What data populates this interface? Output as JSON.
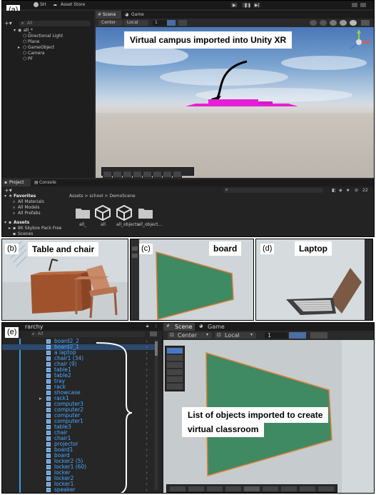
{
  "panel_a": {
    "label": "(a)",
    "toolbar": {
      "account": "SH",
      "asset_store": "Asset Store"
    },
    "hierarchy": {
      "search": "All",
      "scene": "all_*",
      "items": [
        "Directional Light",
        "Plane",
        "GameObject",
        "Camera",
        "PF"
      ]
    },
    "tabs": {
      "scene": "Scene",
      "game": "Game"
    },
    "scene_toolbar": {
      "pivot": "Center",
      "space": "Local",
      "grid_value": "1"
    },
    "caption": "Virtual campus imported into Unity XR",
    "project": {
      "tabs": {
        "project": "Project",
        "console": "Console"
      },
      "favorites_title": "Favorites",
      "favorites": [
        "All Materials",
        "All Models",
        "All Prefabs"
      ],
      "assets_title": "Assets",
      "assets": [
        "8K Skybox Pack Free",
        "Scenes"
      ],
      "breadcrumb": "Assets > school > DemoScene",
      "files": [
        "all_",
        "all",
        "all_objects",
        "all_object..."
      ],
      "count": "22"
    }
  },
  "panel_b": {
    "label": "(b)",
    "caption": "Table and chair"
  },
  "panel_c": {
    "label": "(c)",
    "caption": "board"
  },
  "panel_d": {
    "label": "(d)",
    "caption": "Laptop"
  },
  "panel_e": {
    "label": "(e)",
    "hierarchy_title": "rarchy",
    "search": "All",
    "items": [
      "board2_2",
      "board2_1",
      "a laptop",
      "chair1 (34)",
      "chair (9)",
      "table1",
      "table2",
      "tray",
      "rack",
      "showcase",
      "rack1",
      "computer3",
      "computer2",
      "computer",
      "computer1",
      "table3",
      "chair",
      "chair1",
      "projector",
      "board1",
      "board",
      "locker2 (5)",
      "locker1 (60)",
      "locker",
      "locker2",
      "locker1",
      "speaker",
      "locker 5"
    ],
    "tabs": {
      "scene": "Scene",
      "game": "Game"
    },
    "scene_toolbar": {
      "pivot": "Center",
      "space": "Local",
      "grid_value": "1"
    },
    "caption_line1": "List of objects imported to create",
    "caption_line2": "virtual classroom"
  }
}
